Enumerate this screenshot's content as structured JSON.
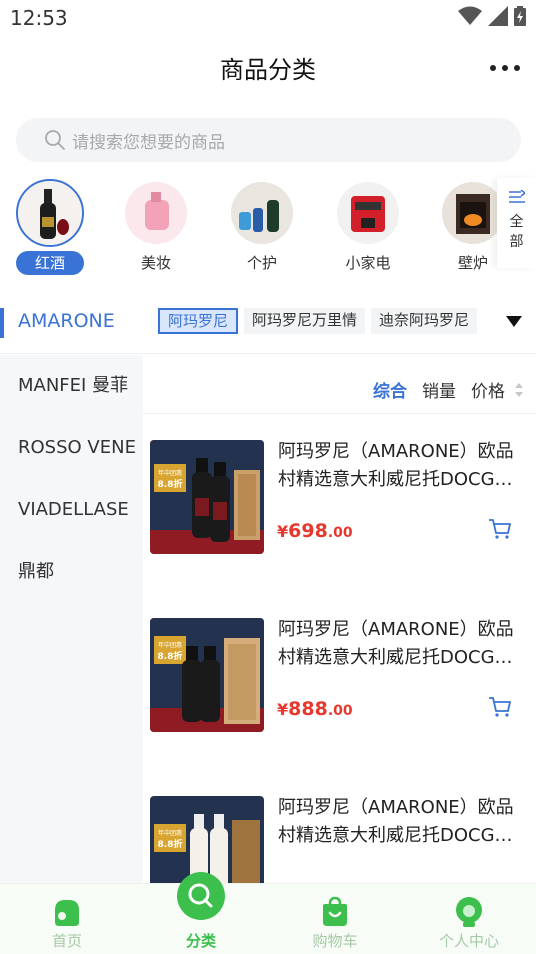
{
  "status_bar": {
    "time": "12:53"
  },
  "header": {
    "title": "商品分类"
  },
  "search": {
    "placeholder": "请搜索您想要的商品"
  },
  "categories": [
    {
      "label": "红酒",
      "active": true
    },
    {
      "label": "美妆",
      "active": false
    },
    {
      "label": "个护",
      "active": false
    },
    {
      "label": "小家电",
      "active": false
    },
    {
      "label": "壁炉",
      "active": false
    }
  ],
  "all_categories_label": "全部",
  "subcategory": {
    "active": "AMARONE",
    "tags": [
      {
        "label": "阿玛罗尼",
        "active": true
      },
      {
        "label": "阿玛罗尼万里情",
        "active": false
      },
      {
        "label": "迪奈阿玛罗尼",
        "active": false
      }
    ]
  },
  "sidebar": {
    "items": [
      "MANFEI 曼菲",
      "ROSSO VENE",
      "VIADELLASE",
      "鼎都"
    ]
  },
  "sort": {
    "comprehensive": "综合",
    "sales": "销量",
    "price": "价格"
  },
  "products": [
    {
      "title_line1": "阿玛罗尼（AMARONE）欧品",
      "title_line2": "村精选意大利威尼托DOCG红葡萄酒",
      "price_symbol": "¥",
      "price_int": "698",
      "price_dec": ".00",
      "badge": "年中团惠 8.8折"
    },
    {
      "title_line1": "阿玛罗尼（AMARONE）欧品",
      "title_line2": "村精选意大利威尼托DOCG红葡萄酒",
      "price_symbol": "¥",
      "price_int": "888",
      "price_dec": ".00",
      "badge": "年中团惠 8.8折"
    },
    {
      "title_line1": "阿玛罗尼（AMARONE）欧品",
      "title_line2": "村精选意大利威尼托DOCG红葡萄酒",
      "price_symbol": "¥",
      "price_int": "",
      "price_dec": "",
      "badge": "年中团惠 8.8折"
    }
  ],
  "bottom_nav": [
    {
      "label": "首页",
      "icon": "home-icon",
      "active": false
    },
    {
      "label": "分类",
      "icon": "search-icon",
      "active": true
    },
    {
      "label": "购物车",
      "icon": "cart-icon",
      "active": false
    },
    {
      "label": "个人中心",
      "icon": "user-icon",
      "active": false
    }
  ],
  "colors": {
    "accent": "#3a73d6",
    "price": "#e8372d",
    "nav_active": "#3cbf4c",
    "nav_inactive": "#a6c9a6"
  }
}
